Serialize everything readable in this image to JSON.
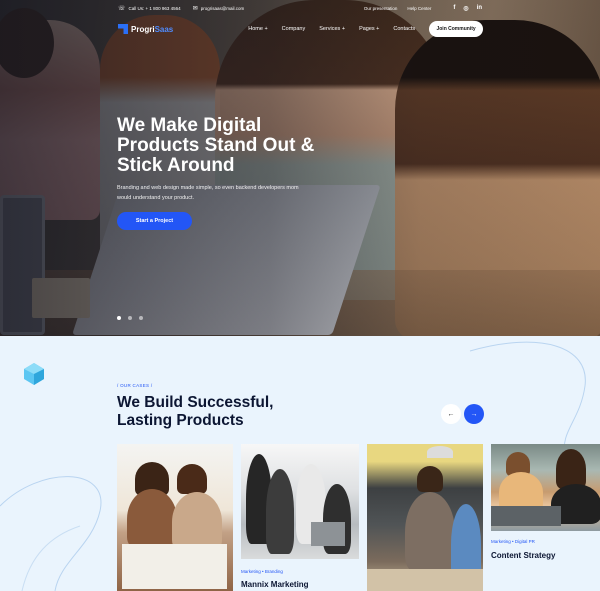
{
  "topbar": {
    "phone": "Call Us: + 1 800 963 4564",
    "email": "progrisaas@mail.com",
    "links": [
      "Our presentation",
      "Help Center"
    ],
    "social": [
      "f",
      "ig",
      "in"
    ]
  },
  "nav": {
    "logo_main": "Progri",
    "logo_accent": "Saas",
    "items": [
      "Home +",
      "Company",
      "Services +",
      "Pages +",
      "Contacts"
    ],
    "cta": "Join Community"
  },
  "hero": {
    "title": "We Make Digital Products Stand Out & Stick Around",
    "description": "Branding and web design made simple, so even backend developers mom would understand your product.",
    "button": "Start a Project",
    "slides_total": 3,
    "active_slide": 1
  },
  "cases": {
    "eyebrow": "/   OUR CASES   /",
    "title": "We Build Successful, Lasting Products",
    "prev_icon": "arrow-left-icon",
    "next_icon": "arrow-right-icon",
    "items": [
      {
        "category": "",
        "name": ""
      },
      {
        "category": "Marketing  •  Branding",
        "name": "Mannix Marketing"
      },
      {
        "category": "",
        "name": ""
      },
      {
        "category": "Marketing  •  Digital PR",
        "name": "Content Strategy"
      }
    ]
  },
  "colors": {
    "accent": "#2356f6",
    "heading": "#0c1633",
    "section_bg": "#eaf4fd"
  }
}
